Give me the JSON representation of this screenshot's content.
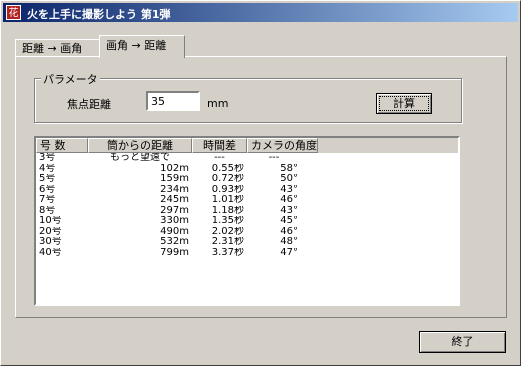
{
  "window": {
    "title": "火を上手に撮影しよう 第1弾",
    "icon_char": "花"
  },
  "tabs": [
    {
      "label": "距離 → 画角",
      "active": false
    },
    {
      "label": "画角 → 距離",
      "active": true
    }
  ],
  "params": {
    "group_label": "パラメータ",
    "focal_label": "焦点距離",
    "focal_value": "35",
    "unit": "mm",
    "calc_label": "計算"
  },
  "table": {
    "headers": [
      "号 数",
      "筒からの距離",
      "時間差",
      "カメラの角度"
    ],
    "rows": [
      [
        "3号",
        "もっと望遠で",
        "---",
        "---"
      ],
      [
        "4号",
        "102m",
        "0.55秒",
        "58°"
      ],
      [
        "5号",
        "159m",
        "0.72秒",
        "50°"
      ],
      [
        "6号",
        "234m",
        "0.93秒",
        "43°"
      ],
      [
        "7号",
        "245m",
        "1.01秒",
        "46°"
      ],
      [
        "8号",
        "297m",
        "1.18秒",
        "43°"
      ],
      [
        "10号",
        "330m",
        "1.35秒",
        "45°"
      ],
      [
        "20号",
        "490m",
        "2.02秒",
        "46°"
      ],
      [
        "30号",
        "532m",
        "2.31秒",
        "48°"
      ],
      [
        "40号",
        "799m",
        "3.37秒",
        "47°"
      ]
    ]
  },
  "footer": {
    "close_label": "終了"
  }
}
